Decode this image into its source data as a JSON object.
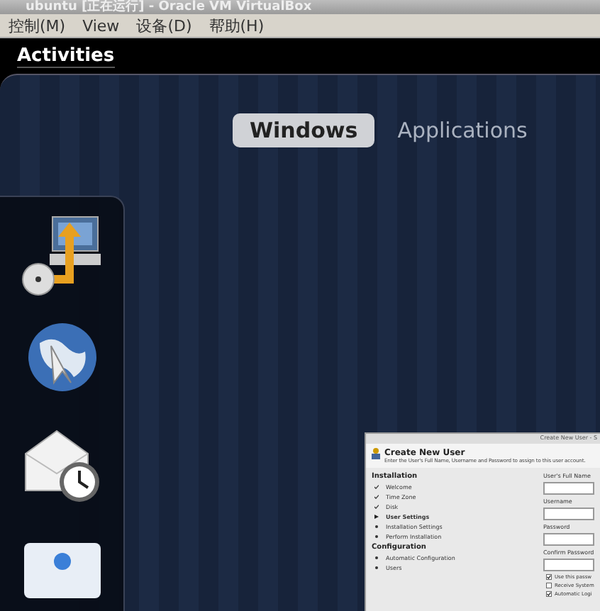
{
  "window": {
    "title": "ubuntu [正在运行] - Oracle VM VirtualBox"
  },
  "menu": [
    {
      "label": "控制(M)"
    },
    {
      "label": "View"
    },
    {
      "label": "设备(D)"
    },
    {
      "label": "帮助(H)"
    }
  ],
  "top_bar": {
    "activities": "Activities"
  },
  "tabs": [
    {
      "label": "Windows",
      "selected": true
    },
    {
      "label": "Applications",
      "selected": false
    }
  ],
  "dash": [
    {
      "kind": "installer"
    },
    {
      "kind": "browser"
    },
    {
      "kind": "mail"
    },
    {
      "kind": "chat"
    }
  ],
  "thumbnail": {
    "title": "Create New User - S",
    "heading": "Create New User",
    "description": "Enter the User's Full Name, Username and Password to assign to this user account.",
    "sections": [
      {
        "title": "Installation",
        "steps": [
          {
            "label": "Welcome",
            "done": true,
            "current": false
          },
          {
            "label": "Time Zone",
            "done": true,
            "current": false
          },
          {
            "label": "Disk",
            "done": true,
            "current": false
          },
          {
            "label": "User Settings",
            "done": false,
            "current": true
          },
          {
            "label": "Installation Settings",
            "done": false,
            "current": false
          },
          {
            "label": "Perform Installation",
            "done": false,
            "current": false
          }
        ]
      },
      {
        "title": "Configuration",
        "steps": [
          {
            "label": "Automatic Configuration",
            "done": false,
            "current": false
          },
          {
            "label": "Users",
            "done": false,
            "current": false
          }
        ]
      }
    ],
    "fields": [
      {
        "label": "User's Full Name"
      },
      {
        "label": "Username"
      },
      {
        "label": "Password"
      },
      {
        "label": "Confirm Password"
      }
    ],
    "checks": [
      {
        "label": "Use this passw",
        "checked": true
      },
      {
        "label": "Receive System",
        "checked": false
      },
      {
        "label": "Automatic Logi",
        "checked": true
      }
    ]
  }
}
